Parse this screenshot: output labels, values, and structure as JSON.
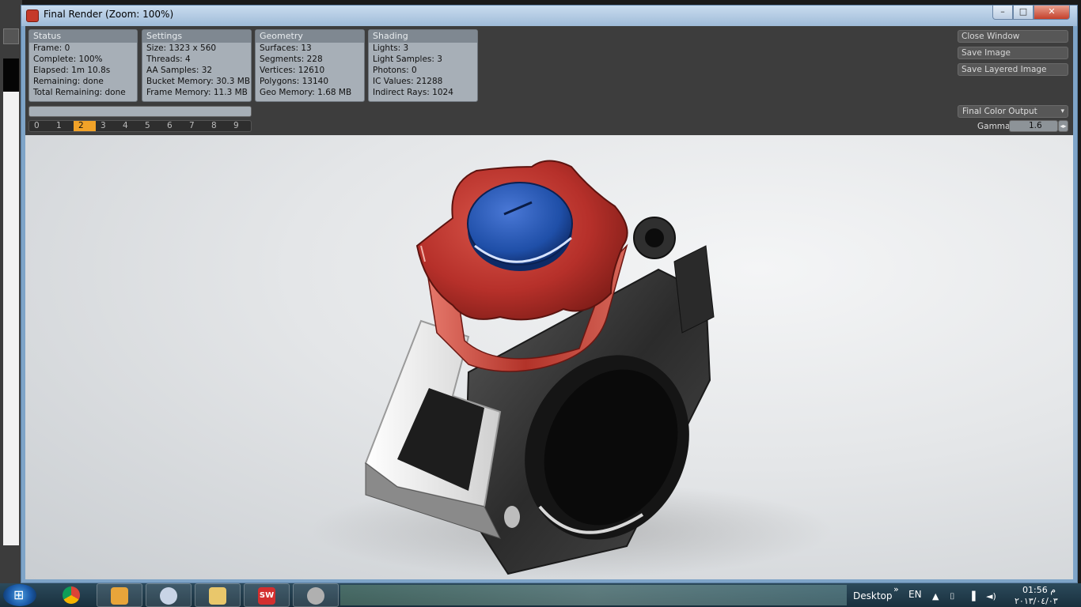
{
  "window": {
    "title": "Final Render (Zoom: 100%)",
    "controls": {
      "minimize": "–",
      "maximize": "□",
      "close": "✕"
    }
  },
  "panels": {
    "status": {
      "header": "Status",
      "rows": [
        "Frame: 0",
        "Complete: 100%",
        "Elapsed: 1m 10.8s",
        "Remaining: done",
        "Total Remaining: done"
      ]
    },
    "settings": {
      "header": "Settings",
      "rows": [
        "Size: 1323 x 560",
        "Threads: 4",
        "AA Samples: 32",
        "Bucket Memory: 30.3 MB",
        "Frame Memory: 11.3 MB"
      ]
    },
    "geometry": {
      "header": "Geometry",
      "rows": [
        "Surfaces: 13",
        "Segments: 228",
        "Vertices: 12610",
        "Polygons: 13140",
        "Geo Memory: 1.68 MB"
      ]
    },
    "shading": {
      "header": "Shading",
      "rows": [
        "Lights: 3",
        "Light Samples: 3",
        "Photons: 0",
        "IC Values: 21288",
        "Indirect Rays: 1024"
      ]
    }
  },
  "progress": {
    "fraction": 1.0
  },
  "buckets": {
    "labels": [
      "0",
      "1",
      "2",
      "3",
      "4",
      "5",
      "6",
      "7",
      "8",
      "9"
    ],
    "active": "2"
  },
  "actions": {
    "close_window": "Close Window",
    "save_image": "Save Image",
    "save_layered_image": "Save Layered Image"
  },
  "output": {
    "selected": "Final Color Output",
    "arrow": "▾"
  },
  "gamma": {
    "label": "Gamma",
    "value": "1.6",
    "stepper": "◂▸"
  },
  "taskbar": {
    "start_glyph": "⊞",
    "sw_label": "SW",
    "desktop": "Desktop",
    "chevron": "»",
    "lang": "EN",
    "tray": [
      "▲",
      "⌷",
      "▐",
      "◄)"
    ],
    "time": "01:56 م",
    "date": "٢٠١٣/٠٤/٠٣"
  },
  "colors": {
    "knob": "#c0392f",
    "cap": "#1f4fa8",
    "clamp": "#3a3a3a",
    "bucket_active": "#f1a228",
    "panel_bg": "#a7afb7"
  },
  "icons": [
    "app-icon",
    "windows-start-icon",
    "chrome-icon",
    "media-player-icon",
    "paint-icon",
    "explorer-icon",
    "solidworks-icon",
    "solidworks-render-icon"
  ]
}
